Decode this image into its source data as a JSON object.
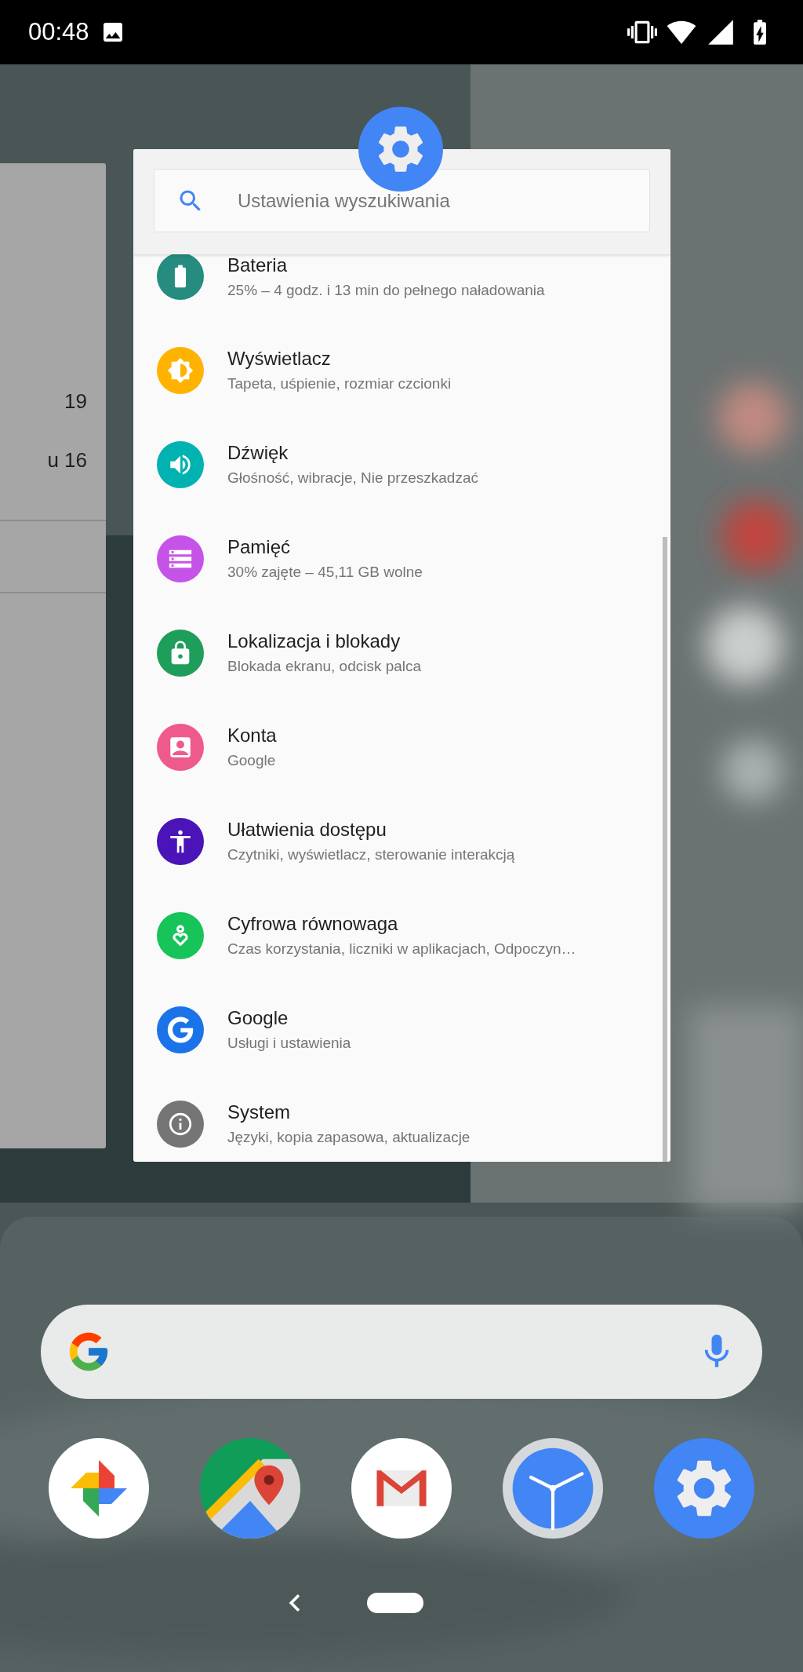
{
  "status_bar": {
    "time": "00:48"
  },
  "left_card": {
    "lines": [
      "19",
      "u 16"
    ]
  },
  "settings_card": {
    "search": {
      "placeholder": "Ustawienia wyszukiwania"
    },
    "items": [
      {
        "title": "Bateria",
        "subtitle": "25% – 4 godz. i 13 min do pełnego naładowania",
        "color": "#268c80"
      },
      {
        "title": "Wyświetlacz",
        "subtitle": "Tapeta, uśpienie, rozmiar czcionki",
        "color": "#ffb300"
      },
      {
        "title": "Dźwięk",
        "subtitle": "Głośność, wibracje, Nie przeszkadzać",
        "color": "#00b3b0"
      },
      {
        "title": "Pamięć",
        "subtitle": "30% zajęte – 45,11 GB wolne",
        "color": "#c653e8"
      },
      {
        "title": "Lokalizacja i blokady",
        "subtitle": "Blokada ekranu, odcisk palca",
        "color": "#1e9e5a"
      },
      {
        "title": "Konta",
        "subtitle": "Google",
        "color": "#ef5a8c"
      },
      {
        "title": "Ułatwienia dostępu",
        "subtitle": "Czytniki, wyświetlacz, sterowanie interakcją",
        "color": "#4a14b8"
      },
      {
        "title": "Cyfrowa równowaga",
        "subtitle": "Czas korzystania, liczniki w aplikacjach, Odpoczyn…",
        "color": "#17c45a"
      },
      {
        "title": "Google",
        "subtitle": "Usługi i ustawienia",
        "color": "#1a73e8"
      },
      {
        "title": "System",
        "subtitle": "Języki, kopia zapasowa, aktualizacje",
        "color": "#757575"
      }
    ]
  }
}
